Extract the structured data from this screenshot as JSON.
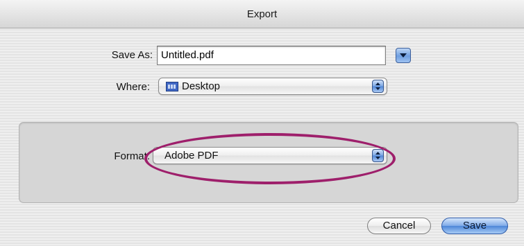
{
  "window": {
    "title": "Export"
  },
  "save_as": {
    "label": "Save As:",
    "value": "Untitled.pdf"
  },
  "expand_button": {
    "icon": "chevron-down-icon"
  },
  "where": {
    "label": "Where:",
    "value": "Desktop",
    "icon": "desktop-folder-icon"
  },
  "format": {
    "label": "Format:",
    "value": "Adobe PDF",
    "highlight_color": "#9e1f6b"
  },
  "buttons": {
    "cancel": "Cancel",
    "save": "Save"
  },
  "colors": {
    "accent": "#6f9fe0"
  }
}
